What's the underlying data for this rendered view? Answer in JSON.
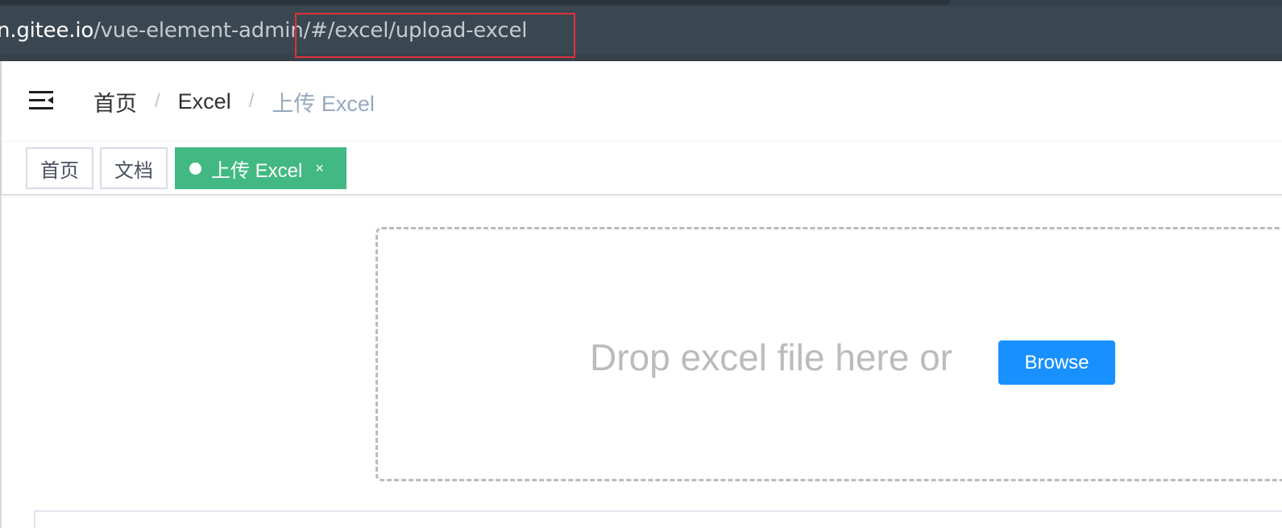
{
  "browser": {
    "url_host": "n.gitee.io",
    "url_path": "/vue-element-admin/#/excel/upload-excel"
  },
  "navbar": {
    "menu_icon": "hamburger-icon",
    "breadcrumb": [
      "首页",
      "Excel",
      "上传 Excel"
    ],
    "separator": "/"
  },
  "tags_view": {
    "tags": [
      {
        "label": "首页",
        "active": false
      },
      {
        "label": "文档",
        "active": false
      },
      {
        "label": "上传 Excel",
        "active": true
      }
    ],
    "close_symbol": "×",
    "active_color": "#42b983"
  },
  "upload": {
    "drop_text": "Drop excel file here or",
    "browse_label": "Browse",
    "button_color": "#1890ff"
  }
}
